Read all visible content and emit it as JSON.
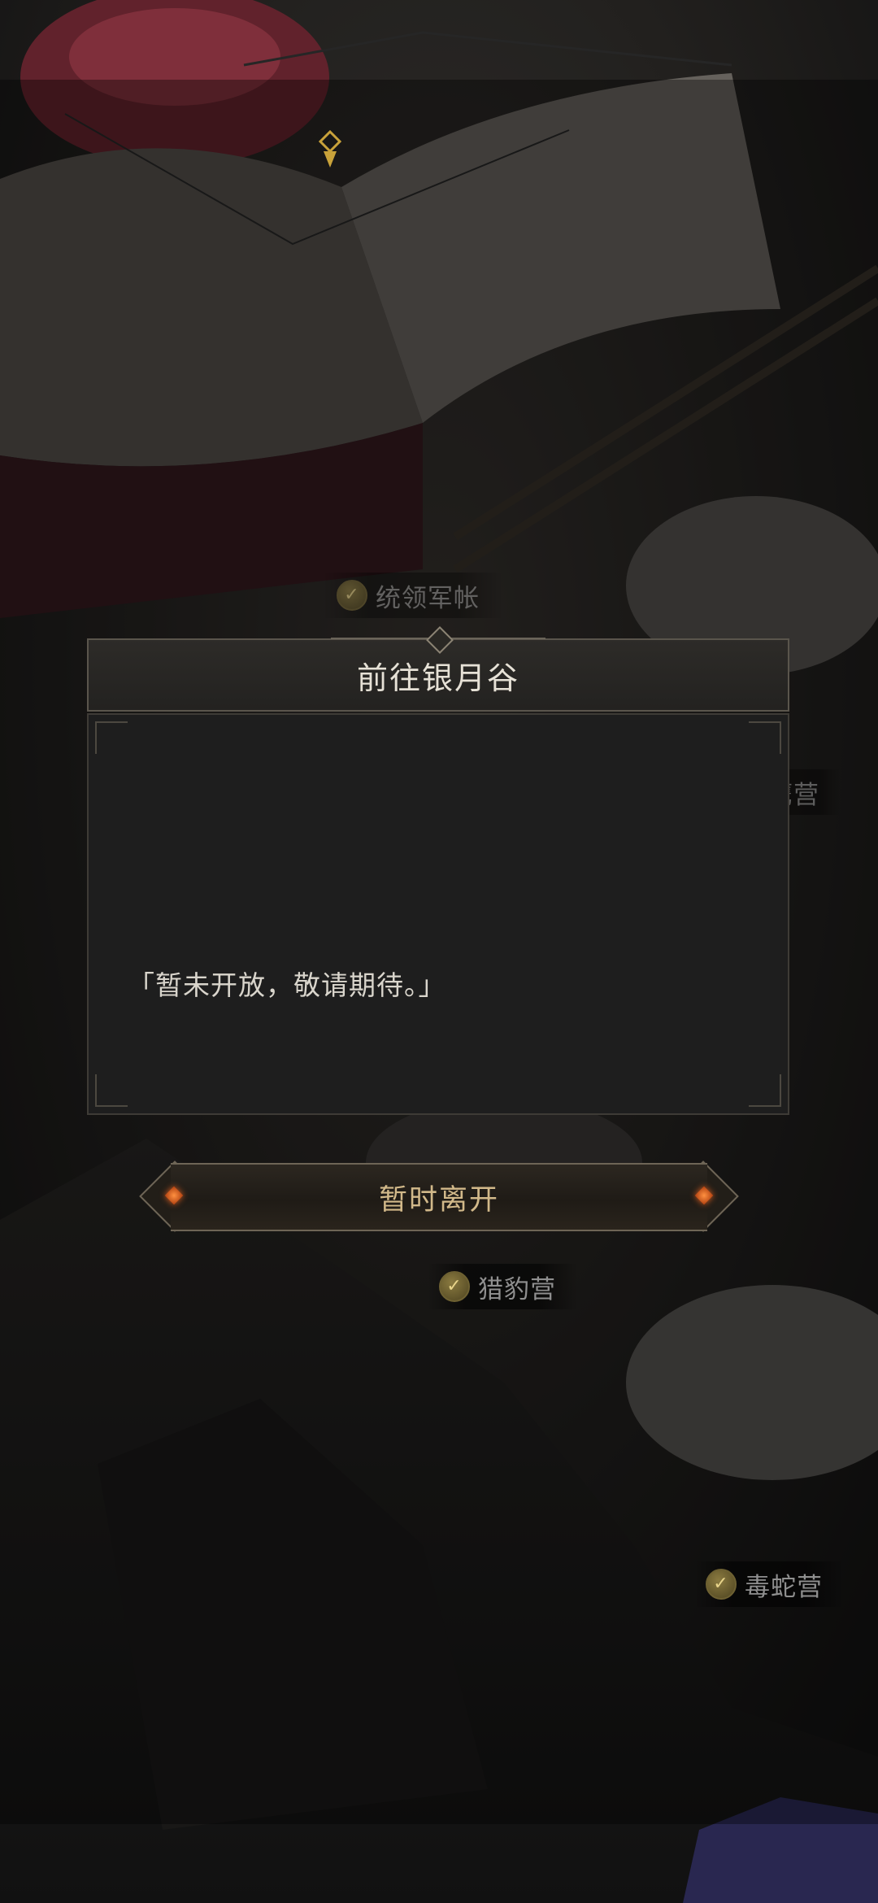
{
  "dialog": {
    "title": "前往银月谷",
    "message": "「暂未开放，敬请期待。」"
  },
  "leave_button": {
    "label": "暂时离开"
  },
  "camps": {
    "commander_tent": "统领军帐",
    "eagle_camp": "鹰营",
    "leopard_camp": "猎豹营",
    "viper_camp": "毒蛇营"
  },
  "colors": {
    "button_text": "#d2b98a",
    "jewel": "#e06020",
    "check": "#8a7a40"
  }
}
